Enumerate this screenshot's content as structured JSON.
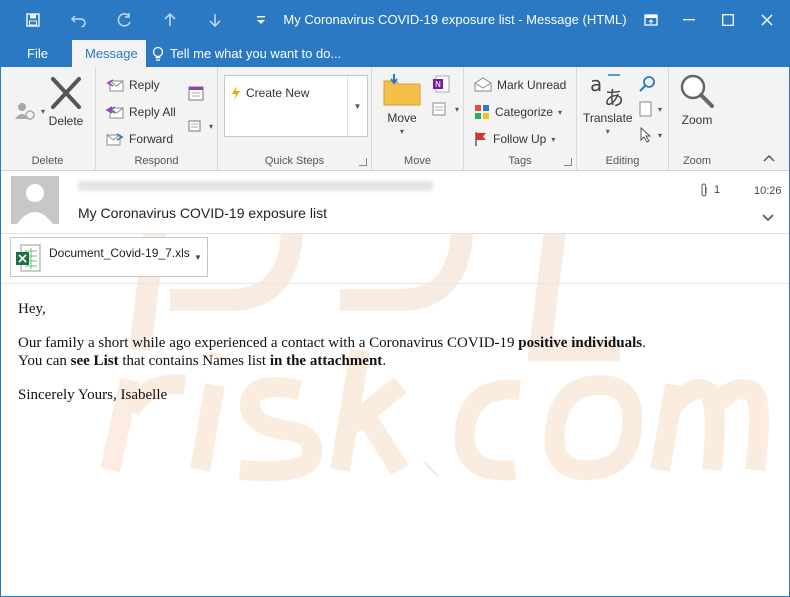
{
  "window": {
    "title": "My Coronavirus COVID-19 exposure list  -  Message (HTML)",
    "controls": {
      "restore": "⧉",
      "minimize": "—",
      "maximize": "☐",
      "close": "✕"
    }
  },
  "tabs": [
    {
      "label": "File",
      "active": false
    },
    {
      "label": "Message",
      "active": true
    }
  ],
  "tell_me": {
    "placeholder": "Tell me what you want to do..."
  },
  "ribbon": {
    "delete": {
      "button": "Delete",
      "group": "Delete"
    },
    "respond": {
      "reply": "Reply",
      "reply_all": "Reply All",
      "forward": "Forward",
      "group": "Respond"
    },
    "quick_steps": {
      "create_new": "Create New",
      "group": "Quick Steps"
    },
    "move": {
      "button": "Move",
      "group": "Move"
    },
    "tags": {
      "mark_unread": "Mark Unread",
      "categorize": "Categorize",
      "follow_up": "Follow Up",
      "group": "Tags"
    },
    "editing": {
      "translate": "Translate",
      "group": "Editing"
    },
    "zoom": {
      "button": "Zoom",
      "group": "Zoom"
    }
  },
  "message": {
    "subject": "My Coronavirus COVID-19 exposure list",
    "attachment_count": "1",
    "time": "10:26",
    "attachment": {
      "filename": "Document_Covid-19_7.xls"
    },
    "body": {
      "greeting": "Hey,",
      "line1_a": "Our family a short while ago experienced a contact with a Coronavirus COVID-19 ",
      "line1_b": "positive individuals",
      "line1_c": ".",
      "line2_a": "You can ",
      "line2_b": "see List",
      "line2_c": " that contains Names list ",
      "line2_d": "in the attachment",
      "line2_e": ".",
      "signature": "Sincerely Yours, Isabelle"
    }
  },
  "colors": {
    "accent": "#2b79c2",
    "ribbon_bg": "#f3f3f3",
    "watermark": "#f6d9c6"
  }
}
